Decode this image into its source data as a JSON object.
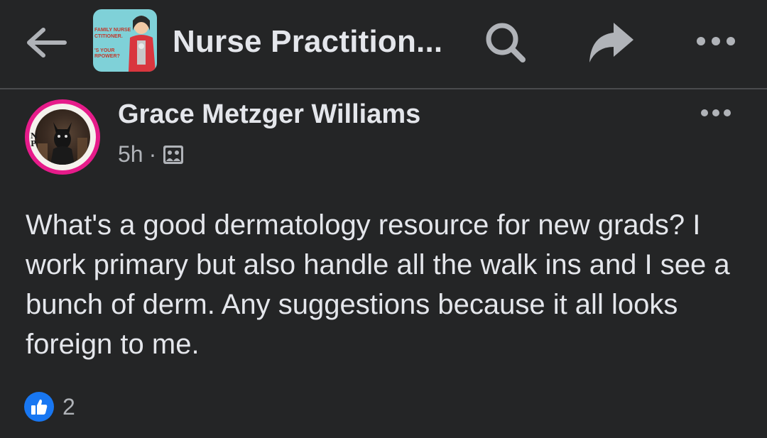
{
  "header": {
    "title": "Nurse Practition...",
    "group_thumb_lines": [
      "FAMILY NURSE",
      "CTITIONER.",
      "'S YOUR",
      "RPOWER?"
    ],
    "back_icon": "arrow-left-icon",
    "search_icon": "search-icon",
    "share_icon": "share-arrow-icon",
    "more_icon": "more-horizontal-icon"
  },
  "post": {
    "author": "Grace Metzger Williams",
    "time": "5h",
    "separator": "·",
    "audience_icon": "group-audience-icon",
    "body": "What's a good dermatology resource for new grads? I work primary but also handle all the walk ins and I see a bunch of derm. Any suggestions because it all looks foreign to me.",
    "reaction_count": "2",
    "avatar_badge": "NP"
  },
  "colors": {
    "background": "#242526",
    "text_primary": "#e4e6eb",
    "text_secondary": "#b0b3b8",
    "like_blue": "#1877f2",
    "avatar_ring": "#e61b8a"
  }
}
